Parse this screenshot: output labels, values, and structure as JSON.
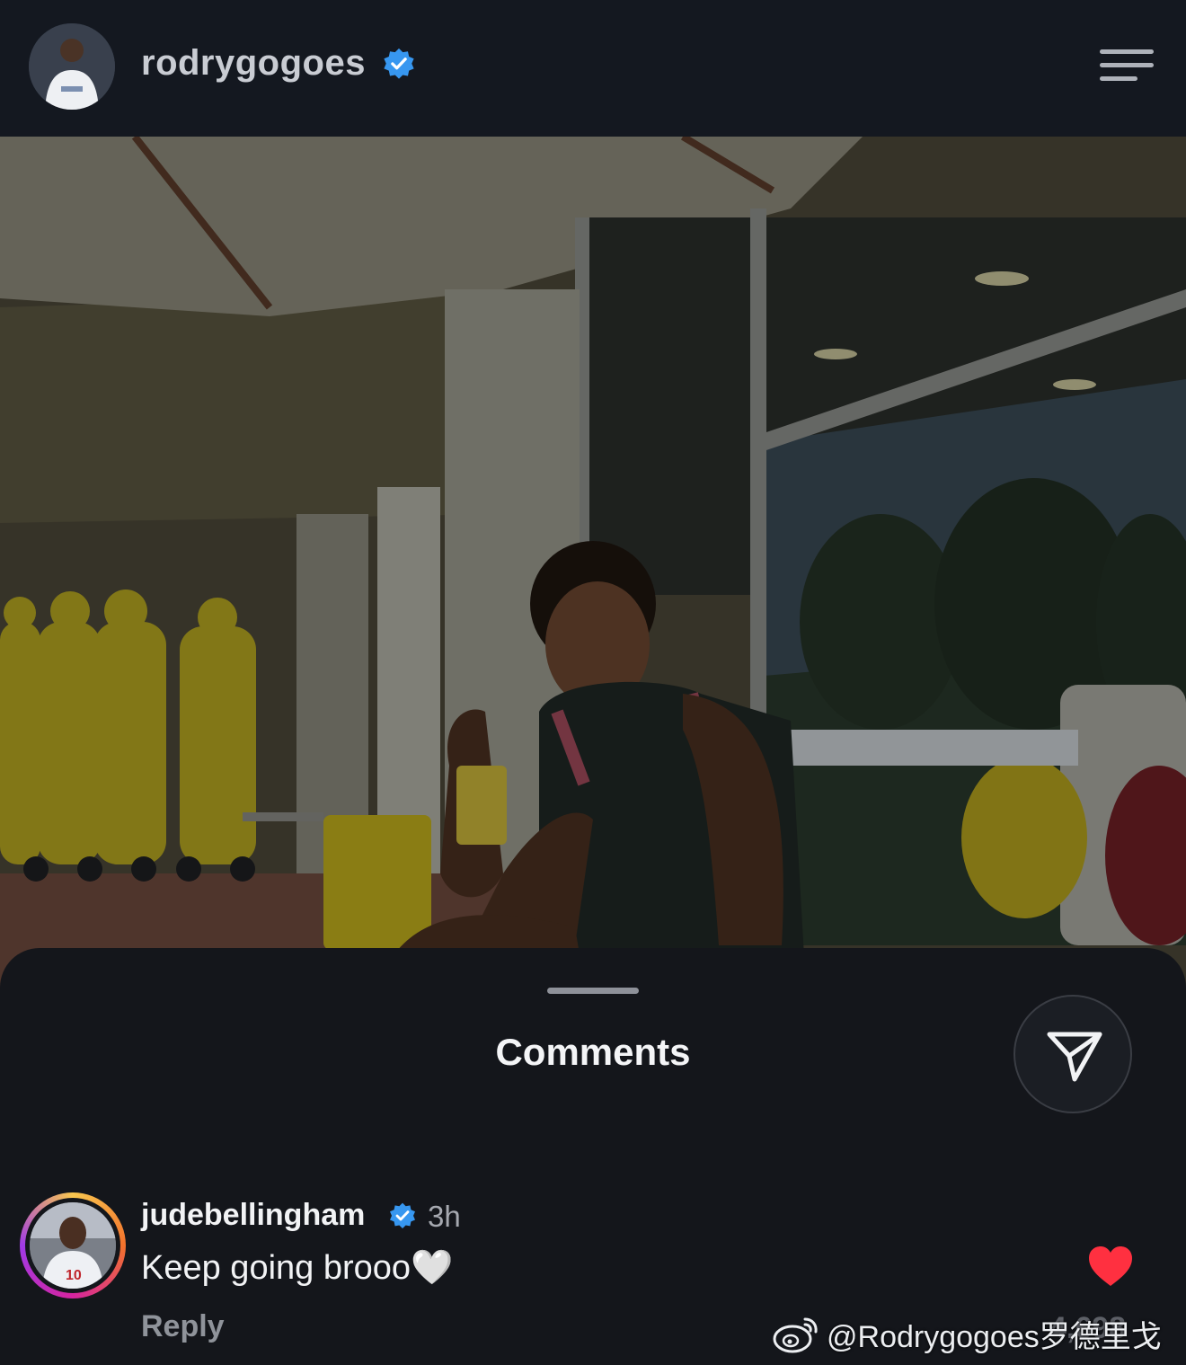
{
  "header": {
    "username": "rodrygogoes",
    "verified": true,
    "menu_icon": "hamburger-menu-icon"
  },
  "post": {
    "image_desc_icon": "post-photo"
  },
  "comments_sheet": {
    "title": "Comments",
    "share_icon": "send-icon",
    "comments": [
      {
        "username": "judebellingham",
        "verified": true,
        "time": "3h",
        "text": "Keep going brooo🤍",
        "reply_label": "Reply",
        "liked": true,
        "like_count": "4,698"
      }
    ]
  },
  "watermark": {
    "text": "@Rodrygogoes罗德里戈"
  },
  "colors": {
    "verified_blue": "#3797f0",
    "like_red": "#ff3040",
    "background": "#14161b"
  }
}
